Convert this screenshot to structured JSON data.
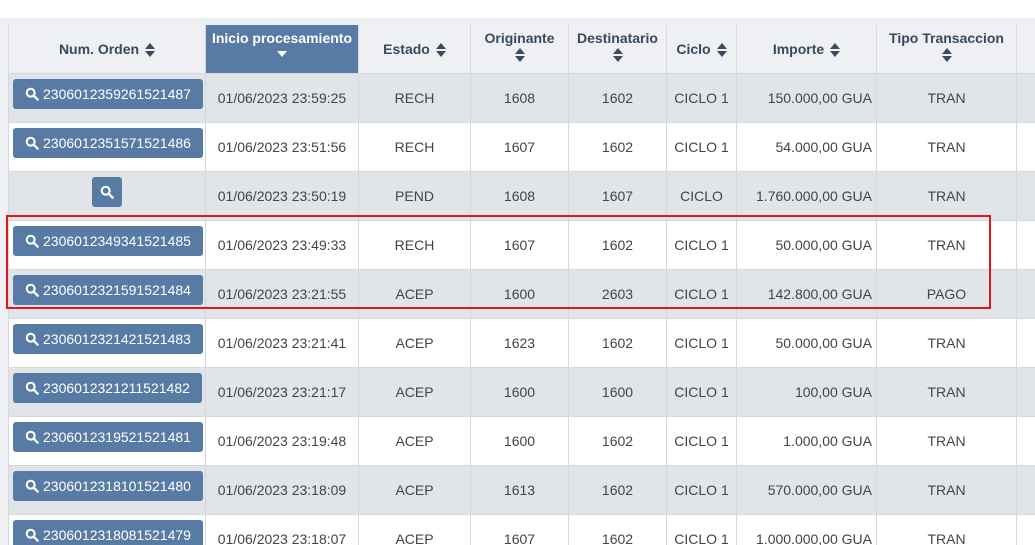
{
  "table": {
    "headers": {
      "orden": "Num. Orden",
      "inicio": "Inicio procesamiento",
      "estado": "Estado",
      "originante": "Originante",
      "destinatario": "Destinatario",
      "ciclo": "Ciclo",
      "importe": "Importe",
      "tipo": "Tipo Transaccion"
    },
    "rows": [
      {
        "orden": "2306012359261521487",
        "inicio": "01/06/2023 23:59:25",
        "estado": "RECH",
        "originante": "1608",
        "destinatario": "1602",
        "ciclo": "CICLO 1",
        "importe": "150.000,00 GUA",
        "tipo": "TRAN"
      },
      {
        "orden": "2306012351571521486",
        "inicio": "01/06/2023 23:51:56",
        "estado": "RECH",
        "originante": "1607",
        "destinatario": "1602",
        "ciclo": "CICLO 1",
        "importe": "54.000,00 GUA",
        "tipo": "TRAN"
      },
      {
        "orden": "",
        "inicio": "01/06/2023 23:50:19",
        "estado": "PEND",
        "originante": "1608",
        "destinatario": "1607",
        "ciclo": "CICLO",
        "importe": "1.760.000,00 GUA",
        "tipo": "TRAN"
      },
      {
        "orden": "2306012349341521485",
        "inicio": "01/06/2023 23:49:33",
        "estado": "RECH",
        "originante": "1607",
        "destinatario": "1602",
        "ciclo": "CICLO 1",
        "importe": "50.000,00 GUA",
        "tipo": "TRAN"
      },
      {
        "orden": "2306012321591521484",
        "inicio": "01/06/2023 23:21:55",
        "estado": "ACEP",
        "originante": "1600",
        "destinatario": "2603",
        "ciclo": "CICLO 1",
        "importe": "142.800,00 GUA",
        "tipo": "PAGO"
      },
      {
        "orden": "2306012321421521483",
        "inicio": "01/06/2023 23:21:41",
        "estado": "ACEP",
        "originante": "1623",
        "destinatario": "1602",
        "ciclo": "CICLO 1",
        "importe": "50.000,00 GUA",
        "tipo": "TRAN"
      },
      {
        "orden": "2306012321211521482",
        "inicio": "01/06/2023 23:21:17",
        "estado": "ACEP",
        "originante": "1600",
        "destinatario": "1600",
        "ciclo": "CICLO 1",
        "importe": "100,00 GUA",
        "tipo": "TRAN"
      },
      {
        "orden": "2306012319521521481",
        "inicio": "01/06/2023 23:19:48",
        "estado": "ACEP",
        "originante": "1600",
        "destinatario": "1602",
        "ciclo": "CICLO 1",
        "importe": "1.000,00 GUA",
        "tipo": "TRAN"
      },
      {
        "orden": "2306012318101521480",
        "inicio": "01/06/2023 23:18:09",
        "estado": "ACEP",
        "originante": "1613",
        "destinatario": "1602",
        "ciclo": "CICLO 1",
        "importe": "570.000,00 GUA",
        "tipo": "TRAN"
      },
      {
        "orden": "2306012318081521479",
        "inicio": "01/06/2023 23:18:07",
        "estado": "ACEP",
        "originante": "1607",
        "destinatario": "1602",
        "ciclo": "CICLO 1",
        "importe": "1.000.000,00 GUA",
        "tipo": "TRAN"
      }
    ]
  },
  "colors": {
    "accent": "#587ba5",
    "highlight": "#e0161a",
    "row_alt": "#e1e4e9"
  },
  "icons": {
    "order_button": "search-icon",
    "sort": "sort-icon"
  }
}
